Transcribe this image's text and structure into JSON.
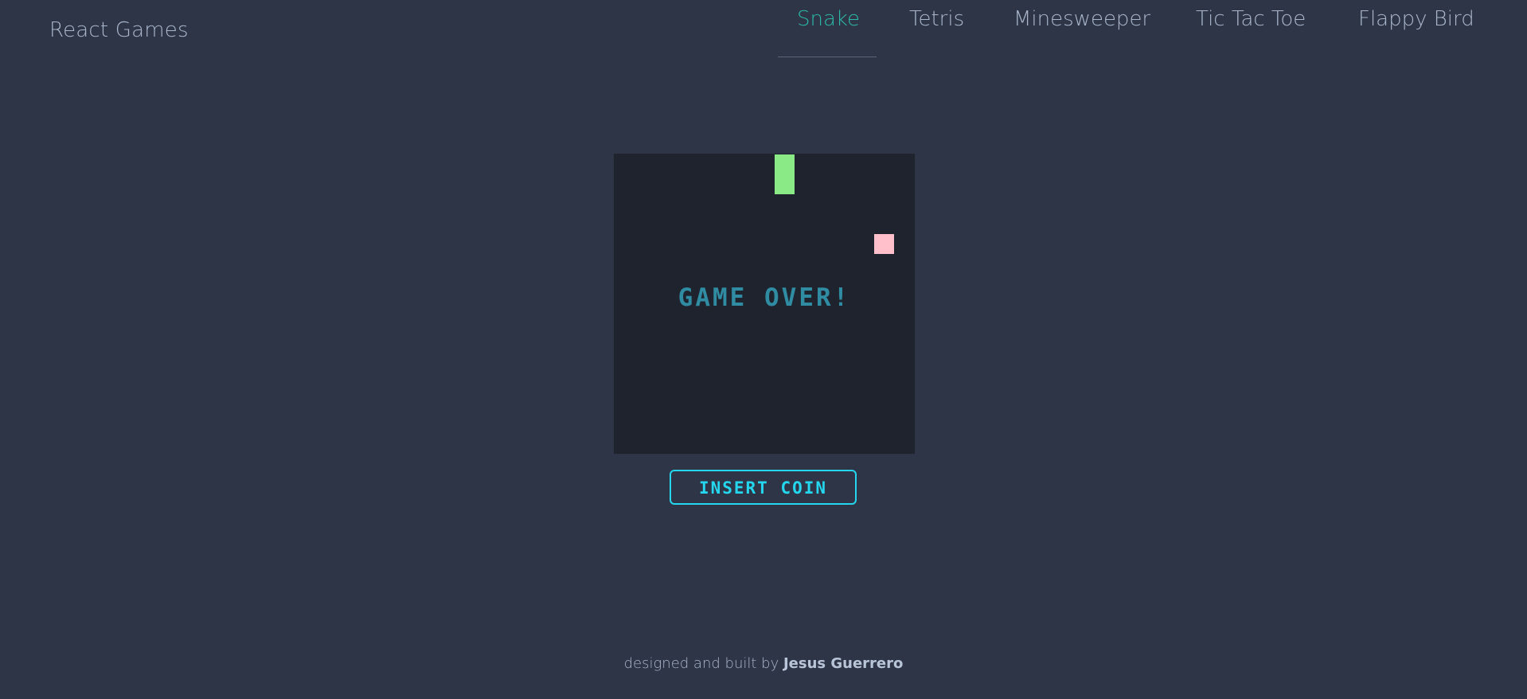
{
  "header": {
    "brand": "React Games",
    "nav": [
      {
        "label": "Snake",
        "active": true
      },
      {
        "label": "Tetris",
        "active": false
      },
      {
        "label": "Minesweeper",
        "active": false
      },
      {
        "label": "Tic Tac Toe",
        "active": false
      },
      {
        "label": "Flappy Bird",
        "active": false
      }
    ]
  },
  "game": {
    "status": "GAME OVER!",
    "button": "INSERT COIN"
  },
  "footer": {
    "prefix": "designed and built by",
    "author": "Jesus Guerrero"
  },
  "colors": {
    "background": "#2e3546",
    "board": "#1e232e",
    "accent": "#2bb8a8",
    "button": "#24d6ee",
    "snake": "#8aea86",
    "food": "#ffbfcb",
    "game_over_text": "#2f8ca3"
  }
}
